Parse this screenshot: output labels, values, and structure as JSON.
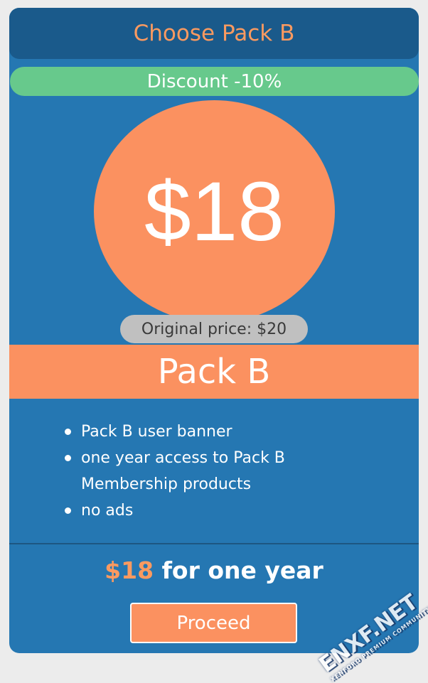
{
  "header": {
    "title": "Choose Pack B"
  },
  "discount": {
    "label": "Discount -10%"
  },
  "price": {
    "amount": "$18",
    "original": "Original price: $20"
  },
  "pack": {
    "name": "Pack B"
  },
  "features": [
    "Pack B user banner",
    "one year access to Pack B Membership products",
    "no ads"
  ],
  "summary": {
    "amount": "$18",
    "period": "for one year"
  },
  "actions": {
    "proceed_label": "Proceed"
  },
  "watermark": {
    "brand": "ENXF.NET",
    "tagline": "XENFORO PREMIUM COMMUNITY"
  },
  "colors": {
    "card": "#2577b2",
    "header": "#1a5a8b",
    "accent": "#fb9160",
    "discount": "#67c98c",
    "original_pill": "#c0c0c0"
  }
}
